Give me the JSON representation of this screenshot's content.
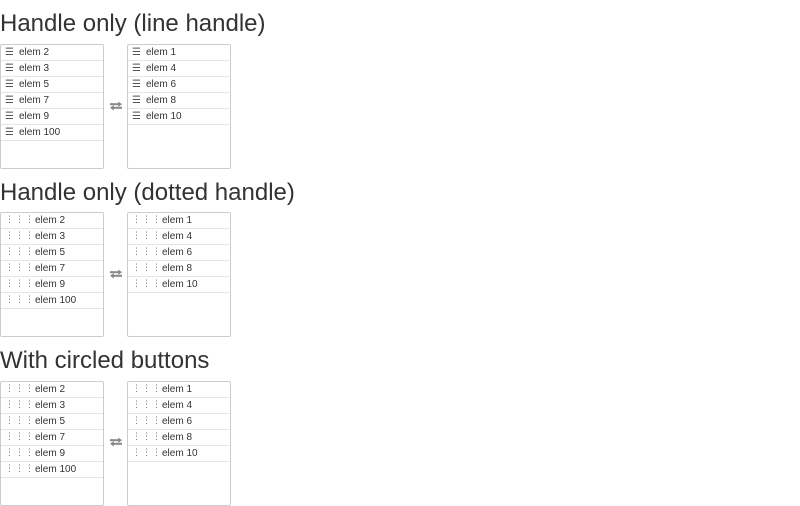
{
  "sections": [
    {
      "title": "Handle only (line handle)",
      "handle_glyph": "☰",
      "left_list": [
        "elem 2",
        "elem 3",
        "elem 5",
        "elem 7",
        "elem 9",
        "elem 100"
      ],
      "right_list": [
        "elem 1",
        "elem 4",
        "elem 6",
        "elem 8",
        "elem 10"
      ],
      "swap_icon": "swap-arrows-icon"
    },
    {
      "title": "Handle only (dotted handle)",
      "handle_glyph": "⋮⋮⋮",
      "left_list": [
        "elem 2",
        "elem 3",
        "elem 5",
        "elem 7",
        "elem 9",
        "elem 100"
      ],
      "right_list": [
        "elem 1",
        "elem 4",
        "elem 6",
        "elem 8",
        "elem 10"
      ],
      "swap_icon": "swap-arrows-icon"
    },
    {
      "title": "With circled buttons",
      "handle_glyph": "⋮⋮⋮",
      "left_list": [
        "elem 2",
        "elem 3",
        "elem 5",
        "elem 7",
        "elem 9",
        "elem 100"
      ],
      "right_list": [
        "elem 1",
        "elem 4",
        "elem 6",
        "elem 8",
        "elem 10"
      ],
      "swap_icon": "swap-arrows-icon"
    }
  ],
  "colors": {
    "border": "#cccccc",
    "row_divider": "#e5e5e5",
    "text": "#333333",
    "icon": "#888888"
  }
}
